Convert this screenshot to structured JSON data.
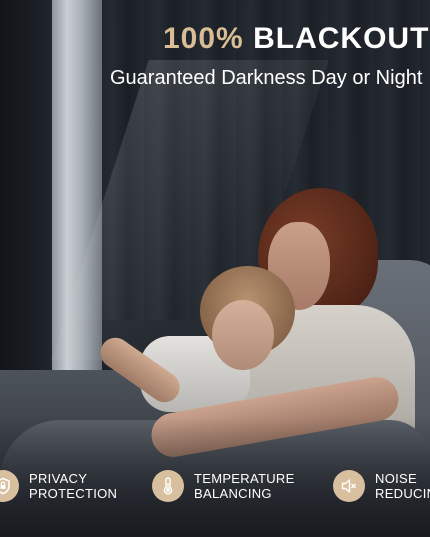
{
  "headline": {
    "accent": "100%",
    "main": "BLACKOUT"
  },
  "subheadline": "Guaranteed Darkness Day or Night",
  "features": [
    {
      "icon": "shield-icon",
      "line1": "PRIVACY",
      "line2": "PROTECTION"
    },
    {
      "icon": "thermometer-icon",
      "line1": "TEMPERATURE",
      "line2": "BALANCING"
    },
    {
      "icon": "speaker-muted-icon",
      "line1": "NOISE",
      "line2": "REDUCING"
    }
  ],
  "colors": {
    "accent": "#d9bd96",
    "icon_badge": "#d8c09f",
    "text": "#ffffff",
    "background": "#1c2026"
  }
}
